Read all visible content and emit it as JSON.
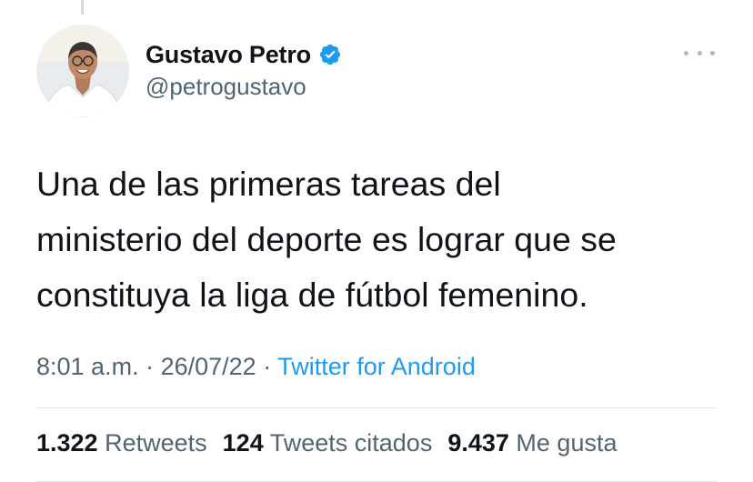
{
  "author": {
    "name": "Gustavo Petro",
    "handle": "@petrogustavo",
    "verified": true
  },
  "tweet": {
    "lines": [
      "Una de las primeras tareas del",
      "ministerio del deporte es lograr que se",
      "constituya la liga de fútbol femenino."
    ],
    "time": "8:01 a.m.",
    "separator": "·",
    "date": "26/07/22",
    "source": "Twitter for Android"
  },
  "stats": {
    "retweets_count": "1.322",
    "retweets_label": "Retweets",
    "quotes_count": "124",
    "quotes_label": "Tweets citados",
    "likes_count": "9.437",
    "likes_label": "Me gusta"
  },
  "icons": {
    "verified": "verified-badge-icon",
    "more": "more-options-icon"
  },
  "colors": {
    "accent": "#1d9bf0",
    "text_primary": "#0f1419",
    "text_secondary": "#536471",
    "divider": "#e1e6ea"
  }
}
